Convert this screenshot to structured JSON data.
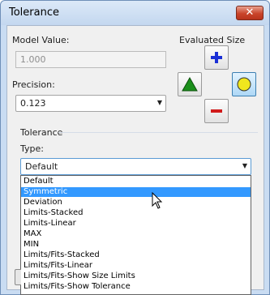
{
  "window": {
    "title": "Tolerance",
    "close_glyph": "✕"
  },
  "model_value": {
    "label": "Model Value:",
    "value": "1.000"
  },
  "precision": {
    "label": "Precision:",
    "value": "0.123"
  },
  "evaluated_size": {
    "label": "Evaluated Size",
    "buttons": [
      {
        "name": "upper",
        "icon": "plus-icon",
        "color": "#1a2fd6"
      },
      {
        "name": "max",
        "icon": "triangle-icon",
        "color": "#1a8f1a"
      },
      {
        "name": "nominal",
        "icon": "circle-icon",
        "color": "#f0e61e",
        "active": true
      },
      {
        "name": "lower",
        "icon": "minus-icon",
        "color": "#d11a1a"
      }
    ]
  },
  "tolerance": {
    "group_label": "Tolerance",
    "type_label": "Type:",
    "type_value": "Default",
    "options": [
      "Default",
      "Symmetric",
      "Deviation",
      "Limits-Stacked",
      "Limits-Linear",
      "MAX",
      "MIN",
      "Limits/Fits-Stacked",
      "Limits/Fits-Linear",
      "Limits/Fits-Show Size Limits",
      "Limits/Fits-Show Tolerance"
    ],
    "highlighted_option": "Symmetric"
  },
  "colors": {
    "selection": "#3399ff",
    "title_bar": "#c3d7ef",
    "close_button": "#c9442a"
  }
}
